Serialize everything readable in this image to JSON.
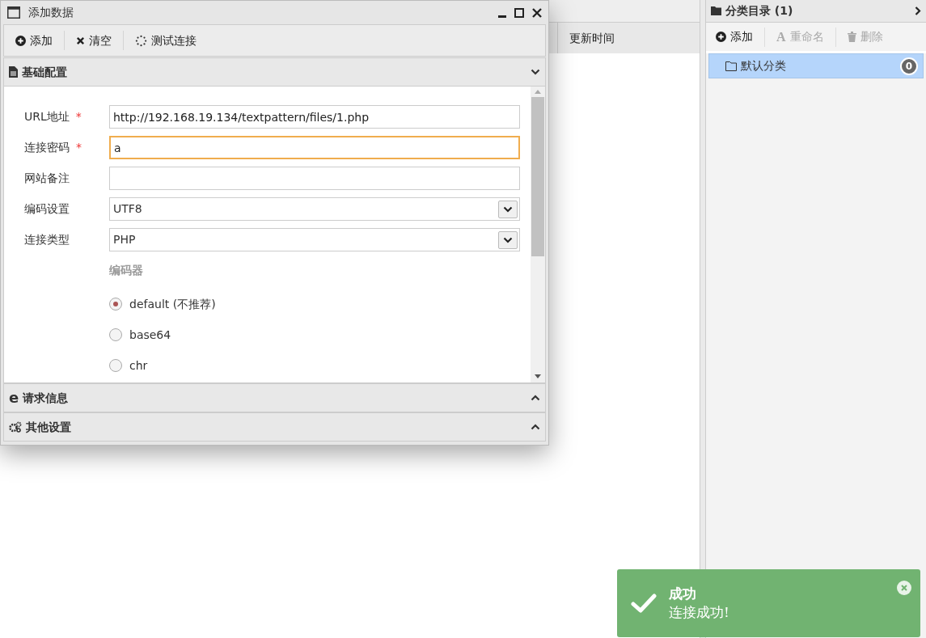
{
  "main": {
    "columns": [
      "更新时间"
    ]
  },
  "category_panel": {
    "title": "分类目录 (1)",
    "toolbar": [
      {
        "label": "添加",
        "disabled": false
      },
      {
        "label": "重命名",
        "glyph": "A",
        "disabled": true
      },
      {
        "label": "删除",
        "disabled": true
      }
    ],
    "items": [
      {
        "label": "默认分类",
        "count": "0",
        "selected": true
      }
    ]
  },
  "dialog": {
    "title": "添加数据",
    "toolbar": [
      {
        "label": "添加"
      },
      {
        "label": "清空"
      },
      {
        "label": "测试连接"
      }
    ],
    "sections": [
      {
        "title": "基础配置",
        "expanded": true
      },
      {
        "title": "请求信息",
        "glyph": "e",
        "expanded": false
      },
      {
        "title": "其他设置",
        "expanded": false
      }
    ],
    "fields": [
      {
        "kind": "text",
        "label": "URL地址",
        "required_mark": "*",
        "value": "http://192.168.19.134/textpattern/files/1.php",
        "focused": false
      },
      {
        "kind": "text",
        "label": "连接密码",
        "required_mark": "*",
        "value": "a",
        "focused": true
      },
      {
        "kind": "text",
        "label": "网站备注",
        "focused": false
      },
      {
        "kind": "select",
        "label": "编码设置",
        "value": "UTF8",
        "focused": false
      },
      {
        "kind": "select",
        "label": "连接类型",
        "value": "PHP",
        "focused": false
      }
    ],
    "encoder": {
      "title": "编码器",
      "options": [
        {
          "label": "default (不推荐)",
          "selected": true
        },
        {
          "label": "base64",
          "selected": false
        },
        {
          "label": "chr",
          "selected": false
        }
      ]
    }
  },
  "toast": {
    "title": "成功",
    "message": "连接成功!"
  }
}
